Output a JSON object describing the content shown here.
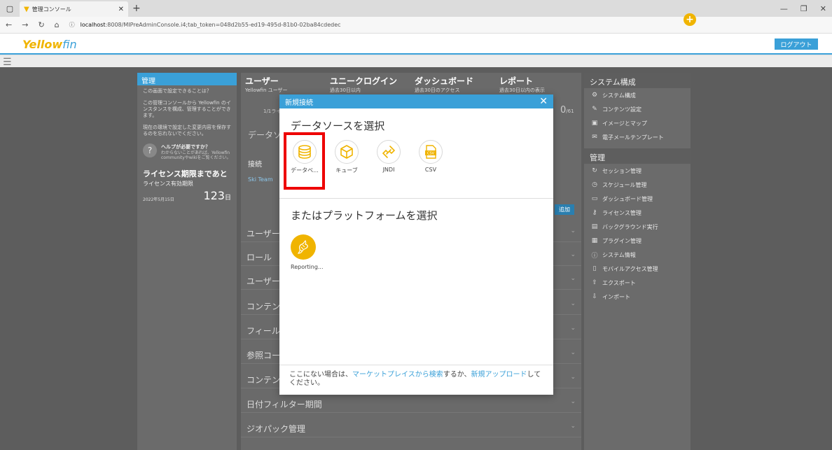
{
  "browser": {
    "tab_title": "管理コンソール",
    "url_host": "localhost",
    "url_rest": ":8008/MIPreAdminConsole.i4;tab_token=048d2b55-ed19-495d-81b0-02ba84cdedec"
  },
  "app": {
    "logo_prefix": "Yellow",
    "logo_suffix": "fin",
    "logout_label": "ログアウト"
  },
  "left_panel": {
    "title": "管理",
    "what_can_do": "この画面で設定できることは？",
    "desc": "この管理コンソールから Yellowfin のインスタンスを構成、管理することができます。",
    "save_note": "現在の環境で設定した変更内容を保存するのを忘れないでください。",
    "help_title": "ヘルプが必要ですか？",
    "help_desc": "わからないことがあれば、Yellowfin communityやwikiをご覧ください。",
    "license_title": "ライセンス期限まであと",
    "license_sub": "ライセンス有効期限",
    "license_date": "2022年5月15日",
    "license_days": "123",
    "license_unit": "日"
  },
  "stats": [
    {
      "label": "ユーザー",
      "sub": "Yellowfin ユーザー"
    },
    {
      "label": "ユニークログイン",
      "sub": "過去30日以内"
    },
    {
      "label": "ダッシュボード",
      "sub": "過去30日のアクセス"
    },
    {
      "label": "レポート",
      "sub": "過去30日以内の表示"
    }
  ],
  "mid": {
    "stat_value_left": "1/1ライ",
    "stat_value_right": "0",
    "stat_value_right_denom": "/61",
    "data_section": "データソ",
    "conn_tab": "接続",
    "conn_row": "Ski Team",
    "add_label": "追加",
    "list": [
      "ユーザー",
      "ロール",
      "ユーザー",
      "コンテン",
      "フィール",
      "参照コー",
      "コンテン",
      "日付フィルター期間",
      "ジオパック管理"
    ]
  },
  "right_panel": {
    "title": "システム構成",
    "items": [
      {
        "icon": "gear-icon",
        "label": "システム構成"
      },
      {
        "icon": "brush-icon",
        "label": "コンテンツ設定"
      },
      {
        "icon": "image-icon",
        "label": "イメージとマップ"
      },
      {
        "icon": "mail-icon",
        "label": "電子メールテンプレート"
      }
    ],
    "admin_title": "管理",
    "admin_items": [
      {
        "icon": "session-icon",
        "label": "セッション管理"
      },
      {
        "icon": "clock-icon",
        "label": "スケジュール管理"
      },
      {
        "icon": "dashboard-icon",
        "label": "ダッシュボード管理"
      },
      {
        "icon": "key-icon",
        "label": "ライセンス管理"
      },
      {
        "icon": "background-icon",
        "label": "バックグラウンド実行"
      },
      {
        "icon": "plugin-icon",
        "label": "プラグイン管理"
      },
      {
        "icon": "info-icon",
        "label": "システム情報"
      },
      {
        "icon": "mobile-icon",
        "label": "モバイルアクセス管理"
      },
      {
        "icon": "export-icon",
        "label": "エクスポート"
      },
      {
        "icon": "import-icon",
        "label": "インポート"
      }
    ]
  },
  "modal": {
    "title": "新規接続",
    "source_heading": "データソースを選択",
    "sources": [
      {
        "icon": "database-icon",
        "label": "データベ..."
      },
      {
        "icon": "cube-icon",
        "label": "キューブ"
      },
      {
        "icon": "jndi-icon",
        "label": "JNDI"
      },
      {
        "icon": "csv-icon",
        "label": "CSV"
      }
    ],
    "platform_heading": "またはプラットフォームを選択",
    "platform_label": "Reporting...",
    "footer_pre": "ここにない場合は、",
    "footer_link1": "マーケットプレイスから検索",
    "footer_mid": "するか、",
    "footer_link2": "新規アップロード",
    "footer_post": "してください。"
  },
  "colors": {
    "accent": "#3aa0d8",
    "brand_yellow": "#f0b400",
    "highlight_red": "#e00000"
  }
}
